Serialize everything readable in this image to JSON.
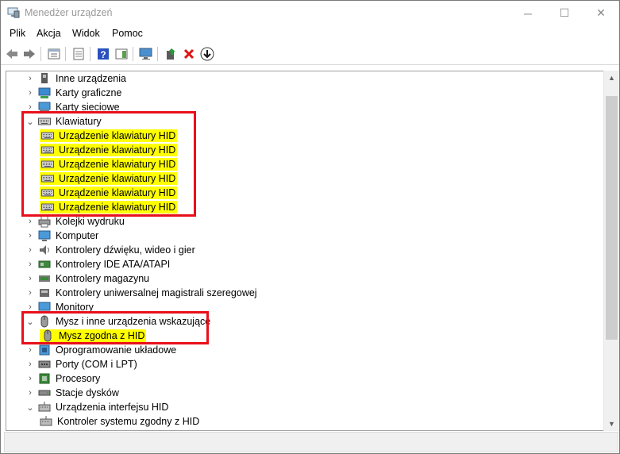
{
  "window": {
    "title": "Menedżer urządzeń",
    "minimize": "─",
    "maximize": "☐",
    "close": "✕"
  },
  "menu": [
    "Plik",
    "Akcja",
    "Widok",
    "Pomoc"
  ],
  "toolbar": {
    "icons": [
      "back-arrow-icon",
      "forward-arrow-icon",
      "show-hide-tree-icon",
      "properties-icon",
      "help-icon",
      "action-pane-icon",
      "computer-monitor-icon",
      "update-driver-icon",
      "uninstall-device-icon",
      "scan-hardware-icon"
    ]
  },
  "tree": {
    "items": [
      {
        "label": "Inne urządzenia",
        "expander": "›",
        "icon": "unknown-device-icon",
        "level": 0,
        "highlight": false
      },
      {
        "label": "Karty graficzne",
        "expander": "›",
        "icon": "display-adapter-icon",
        "level": 0,
        "highlight": false
      },
      {
        "label": "Karty sieciowe",
        "expander": "›",
        "icon": "network-adapter-icon",
        "level": 0,
        "highlight": false
      },
      {
        "label": "Klawiatury",
        "expander": "⌄",
        "icon": "keyboard-icon",
        "level": 0,
        "highlight": false
      },
      {
        "label": "Urządzenie klawiatury HID",
        "expander": "",
        "icon": "keyboard-icon",
        "level": 1,
        "highlight": true
      },
      {
        "label": "Urządzenie klawiatury HID",
        "expander": "",
        "icon": "keyboard-icon",
        "level": 1,
        "highlight": true
      },
      {
        "label": "Urządzenie klawiatury HID",
        "expander": "",
        "icon": "keyboard-icon",
        "level": 1,
        "highlight": true
      },
      {
        "label": "Urządzenie klawiatury HID",
        "expander": "",
        "icon": "keyboard-icon",
        "level": 1,
        "highlight": true
      },
      {
        "label": "Urządzenie klawiatury HID",
        "expander": "",
        "icon": "keyboard-icon",
        "level": 1,
        "highlight": true
      },
      {
        "label": "Urządzenie klawiatury HID",
        "expander": "",
        "icon": "keyboard-icon",
        "level": 1,
        "highlight": true
      },
      {
        "label": "Kolejki wydruku",
        "expander": "›",
        "icon": "printer-icon",
        "level": 0,
        "highlight": false
      },
      {
        "label": "Komputer",
        "expander": "›",
        "icon": "computer-icon",
        "level": 0,
        "highlight": false
      },
      {
        "label": "Kontrolery dźwięku, wideo i gier",
        "expander": "›",
        "icon": "speaker-icon",
        "level": 0,
        "highlight": false
      },
      {
        "label": "Kontrolery IDE ATA/ATAPI",
        "expander": "›",
        "icon": "ide-controller-icon",
        "level": 0,
        "highlight": false
      },
      {
        "label": "Kontrolery magazynu",
        "expander": "›",
        "icon": "storage-controller-icon",
        "level": 0,
        "highlight": false
      },
      {
        "label": "Kontrolery uniwersalnej magistrali szeregowej",
        "expander": "›",
        "icon": "usb-icon",
        "level": 0,
        "highlight": false
      },
      {
        "label": "Monitory",
        "expander": "›",
        "icon": "monitor-icon",
        "level": 0,
        "highlight": false
      },
      {
        "label": "Mysz i inne urządzenia wskazujące",
        "expander": "⌄",
        "icon": "mouse-icon",
        "level": 0,
        "highlight": false
      },
      {
        "label": "Mysz zgodna z HID",
        "expander": "",
        "icon": "mouse-icon",
        "level": 1,
        "highlight": true
      },
      {
        "label": "Oprogramowanie układowe",
        "expander": "›",
        "icon": "firmware-icon",
        "level": 0,
        "highlight": false
      },
      {
        "label": "Porty (COM i LPT)",
        "expander": "›",
        "icon": "port-icon",
        "level": 0,
        "highlight": false
      },
      {
        "label": "Procesory",
        "expander": "›",
        "icon": "processor-icon",
        "level": 0,
        "highlight": false
      },
      {
        "label": "Stacje dysków",
        "expander": "›",
        "icon": "disk-drive-icon",
        "level": 0,
        "highlight": false
      },
      {
        "label": "Urządzenia interfejsu HID",
        "expander": "⌄",
        "icon": "hid-icon",
        "level": 0,
        "highlight": false
      },
      {
        "label": "Kontroler systemu zgodny z HID",
        "expander": "",
        "icon": "hid-icon",
        "level": 1,
        "highlight": false
      }
    ]
  },
  "scrollbar": {
    "up": "▲",
    "down": "▼"
  },
  "colors": {
    "highlight": "#ffff00",
    "annotation_box": "#e8101a"
  }
}
